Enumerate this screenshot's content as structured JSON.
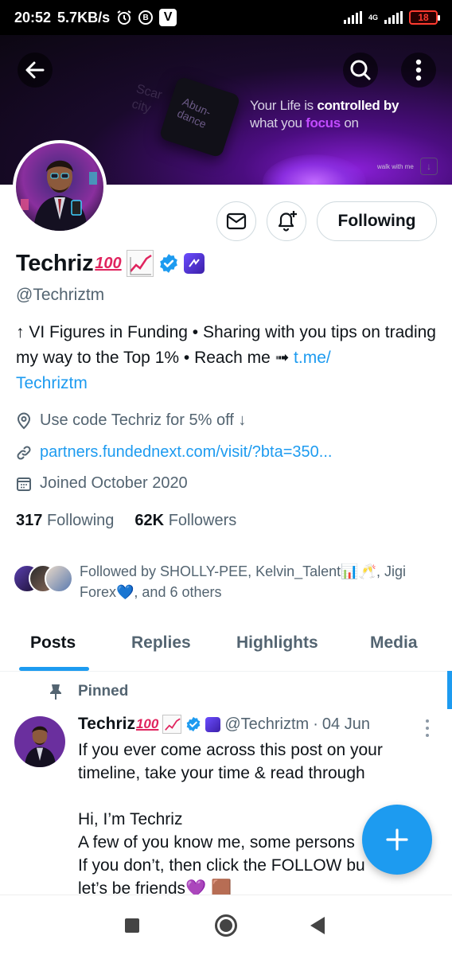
{
  "status_bar": {
    "time": "20:52",
    "speed": "5.7KB/s",
    "b_icon": "B",
    "v_icon": "V",
    "network": "4G",
    "battery": "18"
  },
  "banner": {
    "tile_text": "Abun-\ndance",
    "faint_text": "Scar\ncity",
    "quote_part1": "Your Life is ",
    "quote_bold": "controlled by",
    "quote_part2": " what you ",
    "quote_focus": "focus",
    "quote_part3": " on",
    "small_text": "walk with me",
    "arrow": "↓"
  },
  "profile": {
    "name": "Techriz",
    "hundred_emoji": "100",
    "handle": "@Techriztm",
    "bio_text": "↑ VI Figures in Funding • Sharing with you tips on trading my way to the Top 1% • Reach me ➟ ",
    "bio_link": "t.me/\nTechriztm",
    "location": "Use code Techriz for 5% off ↓",
    "website": "partners.fundednext.com/visit/?bta=350...",
    "joined": "Joined October 2020",
    "following_count": "317",
    "following_label": "Following",
    "followers_count": "62K",
    "followers_label": "Followers",
    "follow_button": "Following",
    "followed_by": "Followed by SHOLLY-PEE, Kelvin_Talent📊🥂, Jigi Forex💙, and 6 others"
  },
  "tabs": [
    "Posts",
    "Replies",
    "Highlights",
    "Media"
  ],
  "post": {
    "pinned_label": "Pinned",
    "name": "Techriz",
    "hundred_emoji": "100",
    "handle": "@Techriztm",
    "separator": "·",
    "date": "04 Jun",
    "body": "If you ever come across this post on your timeline, take your time & read through\n\nHi, I’m Techriz\nA few of you know me, some persons\nIf you don’t, then click the FOLLOW bu\nlet’s be friends💜  🟫"
  },
  "icons": {
    "back": "arrow-left-icon",
    "search": "search-icon",
    "more": "more-vertical-icon",
    "message": "envelope-icon",
    "notify": "bell-plus-icon",
    "verified": "verified-badge-icon",
    "location": "location-pin-icon",
    "link": "link-icon",
    "calendar": "calendar-icon",
    "pin": "pin-icon",
    "compose": "plus-icon"
  },
  "colors": {
    "accent": "#1d9bf0",
    "text": "#0f1419",
    "muted": "#536471"
  }
}
